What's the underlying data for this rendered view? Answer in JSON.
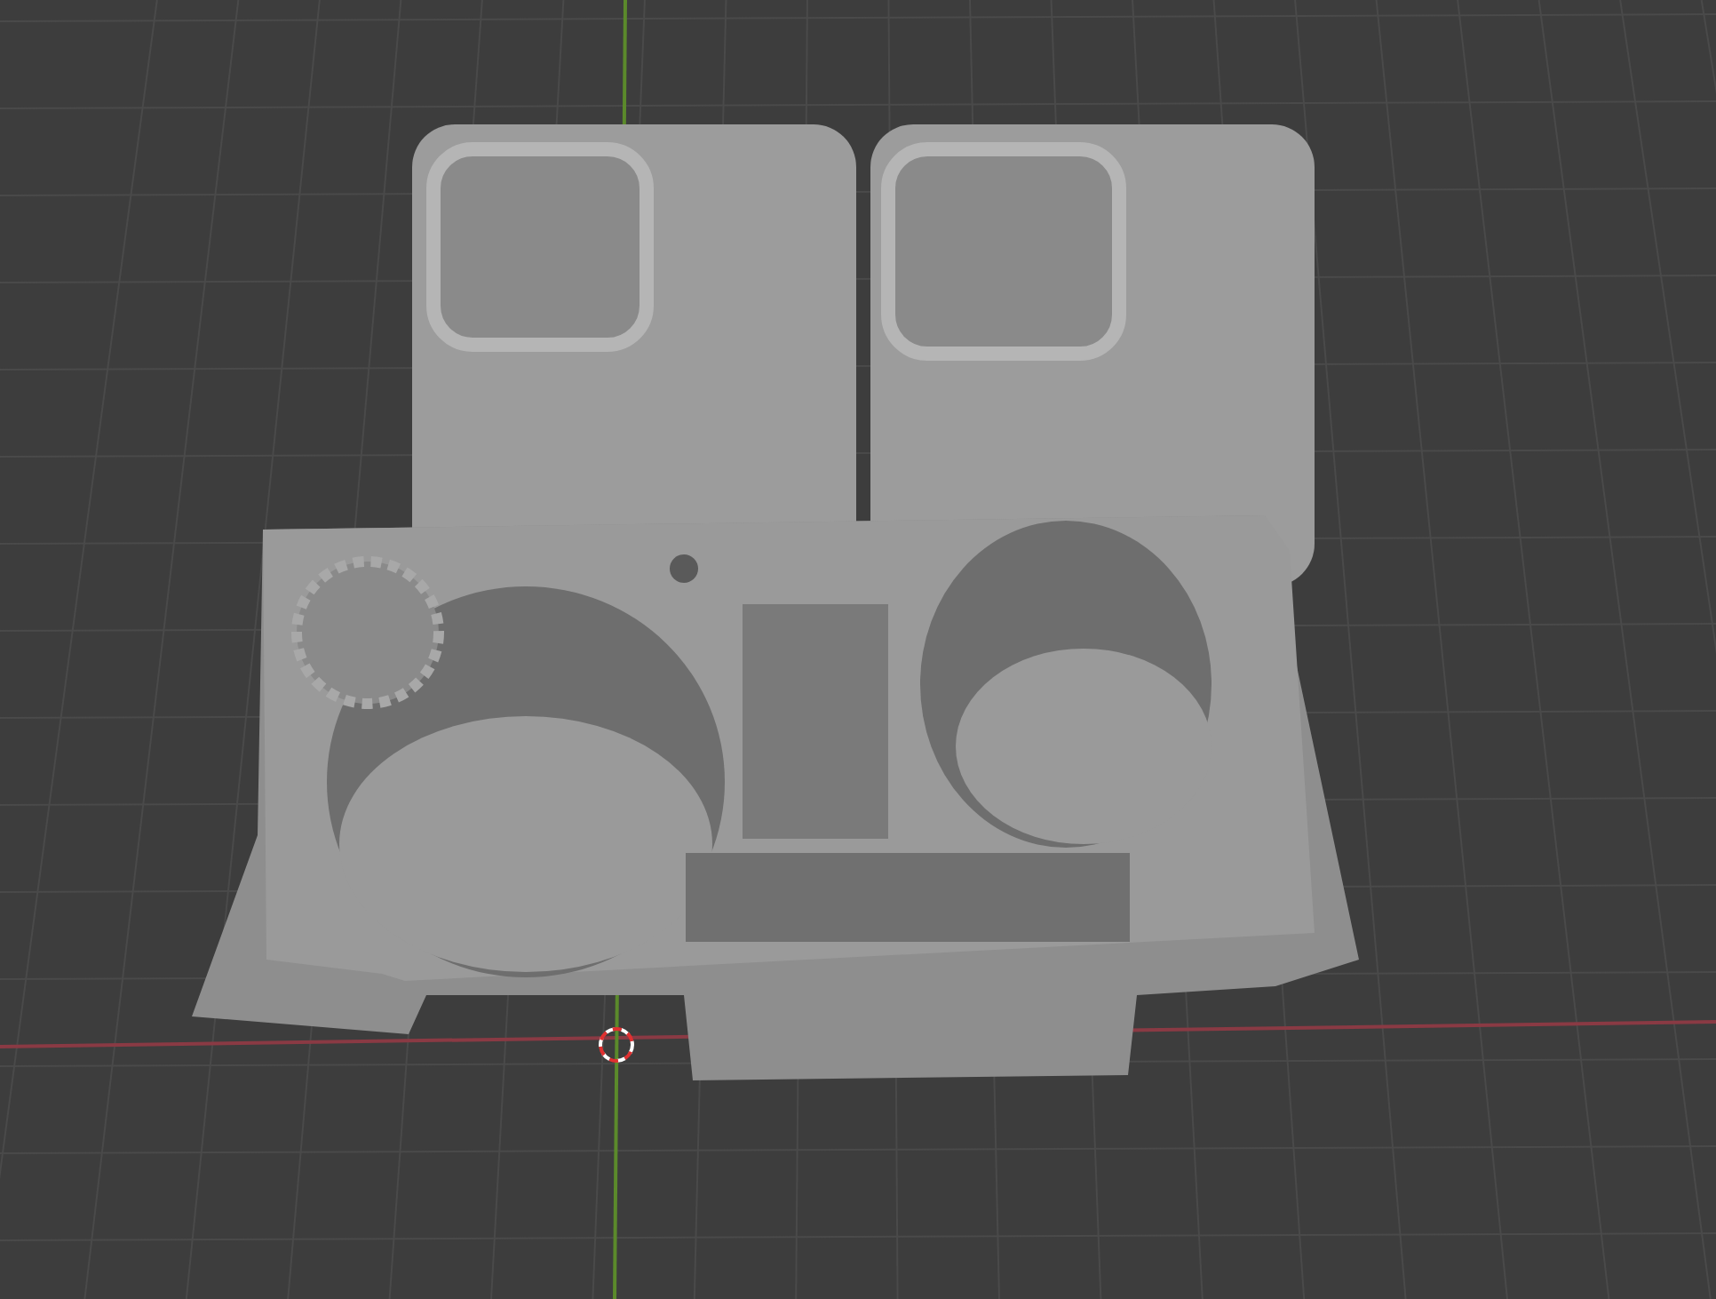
{
  "viewport": {
    "show_grid": true,
    "show_x_axis": true,
    "show_y_axis": true,
    "show_3d_cursor": true
  }
}
